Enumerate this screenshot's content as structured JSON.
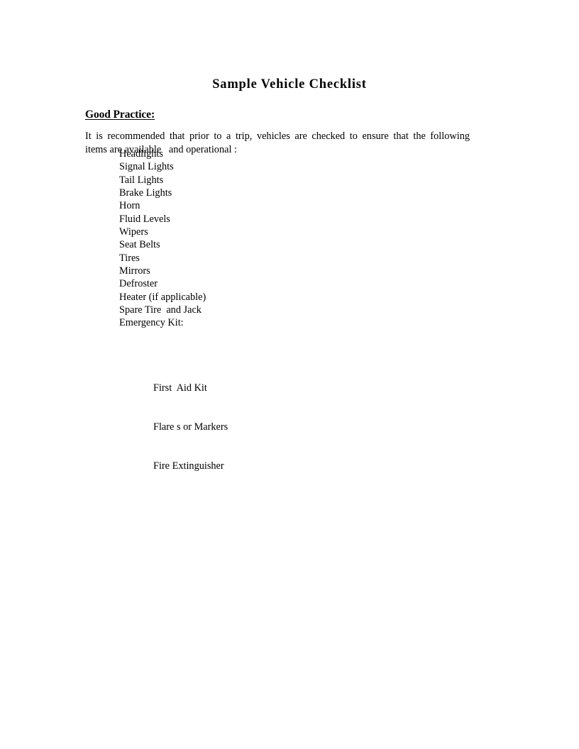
{
  "document": {
    "title": "Sample Vehicle Checklist",
    "section_heading": "Good Practice:",
    "intro": {
      "line_1": "It is recommended that prior to a trip, vehicles are checked to ensure that the following",
      "line_2": "items are available   and operational :"
    },
    "checklist": [
      {
        "label": "Headlights"
      },
      {
        "label": "Signal Lights"
      },
      {
        "label": "Tail Lights"
      },
      {
        "label": "Brake Lights"
      },
      {
        "label": "Horn"
      },
      {
        "label": "Fluid Levels"
      },
      {
        "label": "Wipers"
      },
      {
        "label": "Seat Belts"
      },
      {
        "label": "Tires"
      },
      {
        "label": "Mirrors"
      },
      {
        "label": "Defroster"
      },
      {
        "label": "Heater (if applicable)"
      },
      {
        "label": "Spare Tire  and Jack"
      },
      {
        "label": "Emergency Kit:"
      }
    ],
    "sublist": [
      {
        "label": "First  Aid Kit"
      },
      {
        "label": "Flare s or Markers"
      },
      {
        "label": "Fire Extinguisher"
      }
    ],
    "colors": {
      "page_background": "#ffffff",
      "text": "#000000"
    }
  }
}
